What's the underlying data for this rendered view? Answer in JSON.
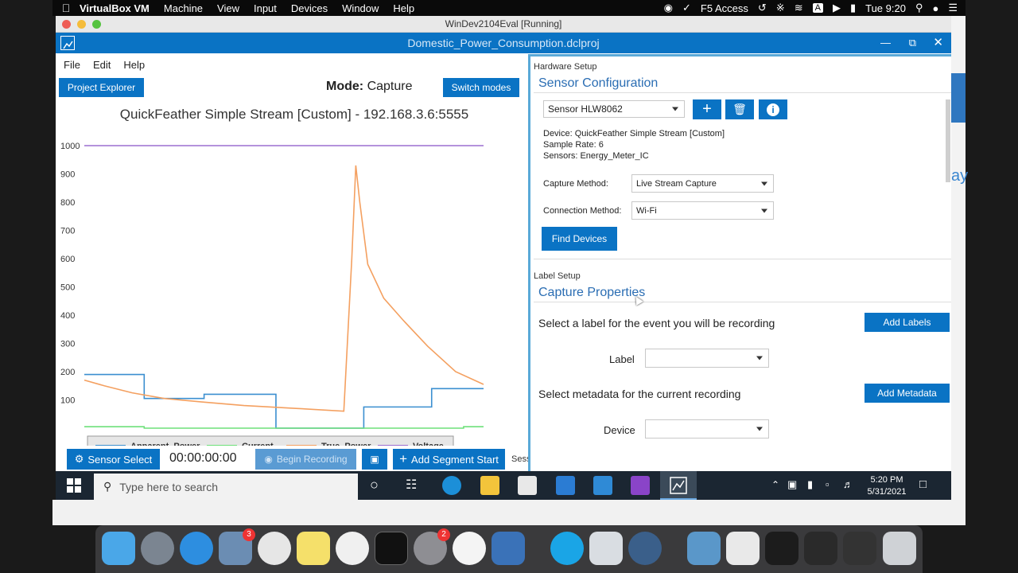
{
  "mac_menubar": {
    "app_name": "VirtualBox VM",
    "menus": [
      "Machine",
      "View",
      "Input",
      "Devices",
      "Window",
      "Help"
    ],
    "status": {
      "f5_label": "F5 Access",
      "input_source": "A",
      "clock": "Tue 9:20"
    }
  },
  "vm_window": {
    "title": "WinDev2104Eval [Running]"
  },
  "app": {
    "title": "Domestic_Power_Consumption.dclproj",
    "menus": [
      "File",
      "Edit",
      "Help"
    ],
    "project_explorer_label": "Project Explorer",
    "mode_label": "Mode:",
    "mode_value": "Capture",
    "switch_modes_label": "Switch modes"
  },
  "chart_data": {
    "type": "line",
    "title": "QuickFeather Simple Stream [Custom] - 192.168.3.6:5555",
    "ylim": [
      0,
      1000
    ],
    "yticks": [
      100,
      200,
      300,
      400,
      500,
      600,
      700,
      800,
      900,
      1000
    ],
    "legend": [
      "Apparent_Power",
      "Current",
      "True_Power",
      "Voltage"
    ],
    "legend_position": "bottom",
    "colors": {
      "Apparent_Power": "#3b8fd0",
      "Current": "#6ee07a",
      "True_Power": "#f4a060",
      "Voltage": "#9b6fd0"
    },
    "series": [
      {
        "name": "Apparent_Power",
        "points": [
          [
            0,
            190
          ],
          [
            15,
            190
          ],
          [
            15,
            105
          ],
          [
            30,
            105
          ],
          [
            30,
            120
          ],
          [
            48,
            120
          ],
          [
            48,
            0
          ],
          [
            70,
            0
          ],
          [
            70,
            75
          ],
          [
            87,
            75
          ],
          [
            87,
            140
          ],
          [
            100,
            140
          ]
        ]
      },
      {
        "name": "Current",
        "points": [
          [
            0,
            5
          ],
          [
            15,
            5
          ],
          [
            15,
            0
          ],
          [
            48,
            0
          ],
          [
            48,
            0
          ],
          [
            95,
            0
          ],
          [
            95,
            5
          ],
          [
            100,
            5
          ]
        ]
      },
      {
        "name": "True_Power",
        "points": [
          [
            0,
            170
          ],
          [
            5,
            150
          ],
          [
            12,
            125
          ],
          [
            20,
            105
          ],
          [
            30,
            92
          ],
          [
            40,
            80
          ],
          [
            53,
            70
          ],
          [
            65,
            60
          ],
          [
            67,
            600
          ],
          [
            68,
            930
          ],
          [
            69,
            800
          ],
          [
            71,
            580
          ],
          [
            75,
            460
          ],
          [
            80,
            380
          ],
          [
            86,
            290
          ],
          [
            93,
            200
          ],
          [
            100,
            155
          ]
        ]
      },
      {
        "name": "Voltage",
        "points": [
          [
            0,
            1000
          ],
          [
            100,
            1000
          ]
        ]
      }
    ]
  },
  "bottom_toolbar": {
    "sensor_select_label": "Sensor Select",
    "timer": "00:00:00:00",
    "begin_recording_label": "Begin Recording",
    "add_segment_label": "Add Segment Start",
    "session_label": "Sess"
  },
  "hardware_setup": {
    "section_label": "Hardware Setup",
    "heading": "Sensor Configuration",
    "sensor_value": "Sensor HLW8062",
    "device_info": "Device: QuickFeather Simple Stream [Custom]",
    "sample_rate": "Sample Rate: 6",
    "sensors": "Sensors: Energy_Meter_IC",
    "capture_method_label": "Capture Method:",
    "capture_method_value": "Live Stream Capture",
    "connection_method_label": "Connection Method:",
    "connection_method_value": "Wi-Fi",
    "find_devices_label": "Find Devices"
  },
  "label_setup": {
    "section_label": "Label Setup",
    "heading": "Capture Properties",
    "label_prompt": "Select a label for the event you will be recording",
    "add_labels_label": "Add Labels",
    "label_field_label": "Label",
    "metadata_prompt": "Select metadata for the current recording",
    "add_metadata_label": "Add Metadata",
    "device_field_label": "Device"
  },
  "taskbar": {
    "search_placeholder": "Type here to search",
    "time": "5:20 PM",
    "date": "5/31/2021"
  },
  "dock": {
    "badges": {
      "mail": "3",
      "settings": "2"
    }
  }
}
